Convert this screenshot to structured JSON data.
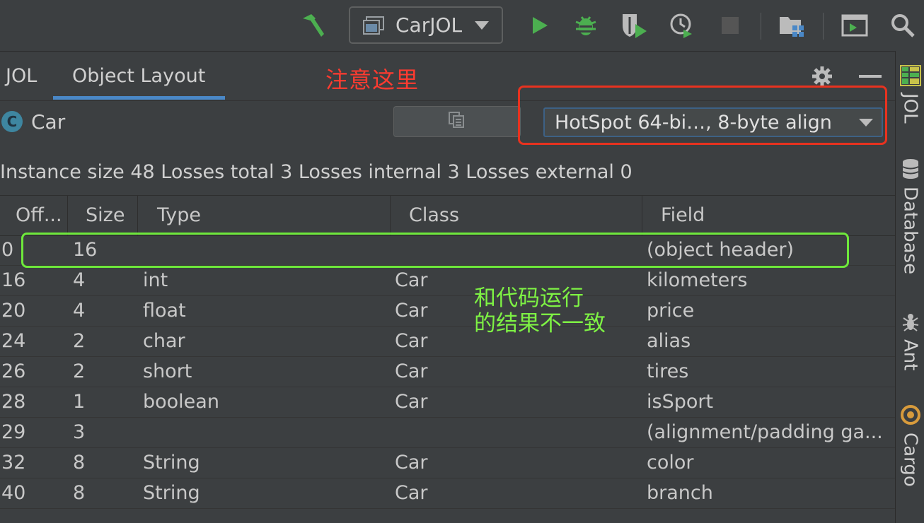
{
  "toolbar": {
    "run_config": "CarJOL",
    "icons": [
      "hammer-icon",
      "run-icon",
      "debug-icon",
      "coverage-icon",
      "profile-icon",
      "stop-icon",
      "project-structure-icon",
      "terminal-icon",
      "search-icon"
    ],
    "colors": {
      "run": "#4caf50",
      "debug": "#4caf50",
      "stop": "#555555"
    }
  },
  "tool_window": {
    "tabs": [
      {
        "label": "JOL"
      },
      {
        "label": "Object Layout"
      }
    ],
    "active_tab": "Object Layout",
    "annotation": "注意这里"
  },
  "class_row": {
    "badge": "C",
    "class_name": "Car",
    "vm_option": "HotSpot 64-bi…, 8-byte align"
  },
  "summary": "Instance size 48 Losses total 3 Losses internal 3 Losses external 0",
  "table": {
    "headers": [
      "Off...",
      "Size",
      "Type",
      "Class",
      "Field"
    ],
    "rows": [
      {
        "offset": "0",
        "size": "16",
        "type": "",
        "class": "",
        "field": "(object header)"
      },
      {
        "offset": "16",
        "size": "4",
        "type": "int",
        "class": "Car",
        "field": "kilometers"
      },
      {
        "offset": "20",
        "size": "4",
        "type": "float",
        "class": "Car",
        "field": "price"
      },
      {
        "offset": "24",
        "size": "2",
        "type": "char",
        "class": "Car",
        "field": "alias"
      },
      {
        "offset": "26",
        "size": "2",
        "type": "short",
        "class": "Car",
        "field": "tires"
      },
      {
        "offset": "28",
        "size": "1",
        "type": "boolean",
        "class": "Car",
        "field": "isSport"
      },
      {
        "offset": "29",
        "size": "3",
        "type": "",
        "class": "",
        "field": "(alignment/padding ga..."
      },
      {
        "offset": "32",
        "size": "8",
        "type": "String",
        "class": "Car",
        "field": "color"
      },
      {
        "offset": "40",
        "size": "8",
        "type": "String",
        "class": "Car",
        "field": "branch"
      }
    ]
  },
  "annotation_green": {
    "line1": "和代码运行",
    "line2": "的结果不一致"
  },
  "sidebar": {
    "items": [
      {
        "label": "JOL"
      },
      {
        "label": "Database"
      },
      {
        "label": "Ant"
      },
      {
        "label": "Cargo"
      }
    ]
  },
  "colors": {
    "accent": "#4a88c7",
    "annotation_red": "#ff3b30",
    "annotation_green": "#7ef244"
  }
}
